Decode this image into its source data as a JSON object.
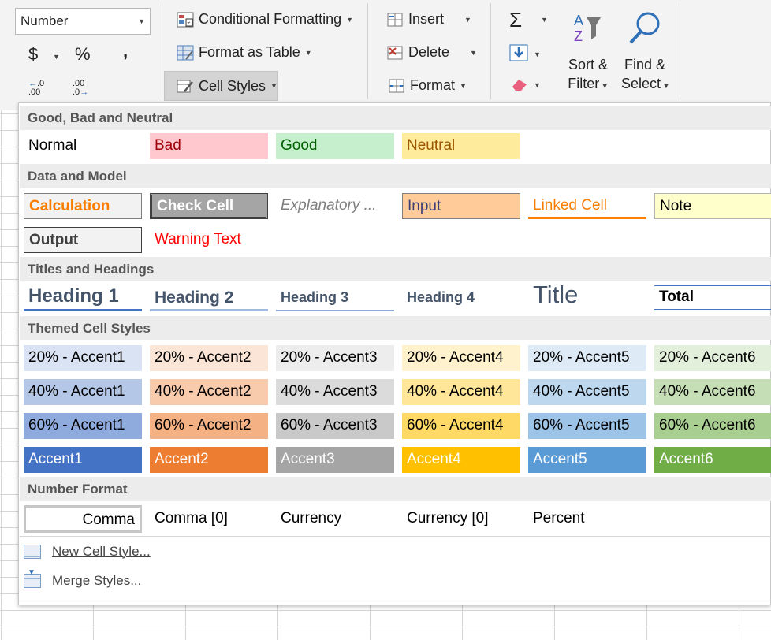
{
  "ribbon": {
    "number_format": "Number",
    "currency_symbol": "$",
    "percent_symbol": "%",
    "comma_symbol": ",",
    "increase_decimal": ".0\n.00",
    "decrease_decimal": ".00\n.0",
    "conditional_formatting": "Conditional Formatting",
    "format_as_table": "Format as Table",
    "cell_styles": "Cell Styles",
    "insert": "Insert",
    "delete": "Delete",
    "format": "Format",
    "sort_filter_1": "Sort &",
    "sort_filter_2": "Filter",
    "find_select_1": "Find &",
    "find_select_2": "Select"
  },
  "gallery": {
    "sections": {
      "good_bad": "Good, Bad and Neutral",
      "data_model": "Data and Model",
      "titles": "Titles and Headings",
      "themed": "Themed Cell Styles",
      "number": "Number Format"
    },
    "good_bad": [
      "Normal",
      "Bad",
      "Good",
      "Neutral"
    ],
    "data_model": [
      "Calculation",
      "Check Cell",
      "Explanatory ...",
      "Input",
      "Linked Cell",
      "Note",
      "Output",
      "Warning Text"
    ],
    "titles": [
      "Heading 1",
      "Heading 2",
      "Heading 3",
      "Heading 4",
      "Title",
      "Total"
    ],
    "themed_20": [
      "20% - Accent1",
      "20% - Accent2",
      "20% - Accent3",
      "20% - Accent4",
      "20% - Accent5",
      "20% - Accent6"
    ],
    "themed_40": [
      "40% - Accent1",
      "40% - Accent2",
      "40% - Accent3",
      "40% - Accent4",
      "40% - Accent5",
      "40% - Accent6"
    ],
    "themed_60": [
      "60% - Accent1",
      "60% - Accent2",
      "60% - Accent3",
      "60% - Accent4",
      "60% - Accent5",
      "60% - Accent6"
    ],
    "themed_100": [
      "Accent1",
      "Accent2",
      "Accent3",
      "Accent4",
      "Accent5",
      "Accent6"
    ],
    "number": [
      "Comma",
      "Comma [0]",
      "Currency",
      "Currency [0]",
      "Percent"
    ]
  },
  "menu": {
    "new_style": "New Cell Style...",
    "merge_styles": "Merge Styles..."
  },
  "colors": {
    "accent1": "#4472c4",
    "accent2": "#ed7d31",
    "accent3": "#a5a5a5",
    "accent4": "#ffc000",
    "accent5": "#5b9bd5",
    "accent6": "#70ad47"
  }
}
